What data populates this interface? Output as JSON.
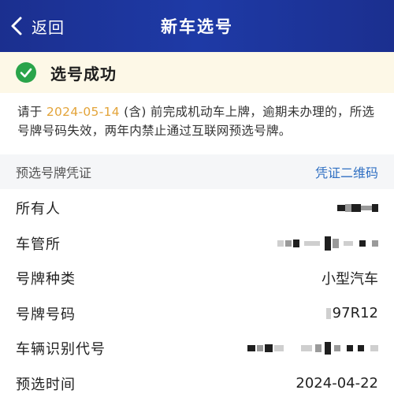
{
  "nav": {
    "back_label": "返回",
    "title": "新车选号"
  },
  "status": {
    "text": "选号成功"
  },
  "notice": {
    "prefix": "请于",
    "date": "2024-05-14",
    "suffix": "(含) 前完成机动车上牌，逾期未办理的，所选号牌号码失效，两年内禁止通过互联网预选号牌。"
  },
  "certificate": {
    "label": "预选号牌凭证",
    "link": "凭证二维码"
  },
  "rows": [
    {
      "label": "所有人",
      "value": ""
    },
    {
      "label": "车管所",
      "value": ""
    },
    {
      "label": "号牌种类",
      "value": "小型汽车"
    },
    {
      "label": "号牌号码",
      "value": "97R12"
    },
    {
      "label": "车辆识别代号",
      "value": ""
    },
    {
      "label": "预选时间",
      "value": "2024-04-22"
    }
  ],
  "colors": {
    "nav_bg": "#1e3aa6",
    "status_bg": "#fdf8e7",
    "success": "#2aa44a",
    "highlight_date": "#e3a43a",
    "link": "#2f6fc2"
  }
}
